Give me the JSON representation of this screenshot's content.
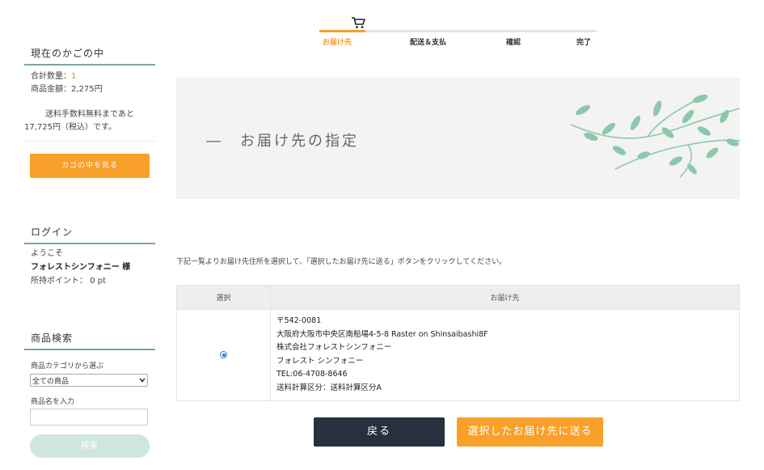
{
  "colors": {
    "accent": "#f8a02a",
    "heading_line": "#7aa898",
    "dark_button": "#26303e",
    "search_button": "#cfe6de",
    "leaf": "#8cc8aa"
  },
  "steps": {
    "icon": "cart-icon",
    "items": [
      "お届け先",
      "配送＆支払",
      "確認",
      "完了"
    ],
    "active_index": 0
  },
  "sidebar": {
    "cart": {
      "heading": "現在のかごの中",
      "qty_label": "合計数量：",
      "qty_value": "1",
      "price": "商品金額：2,275円",
      "note_line1": "送料手数料無料まであと",
      "note_line2": "17,725円（税込）です。",
      "view_cart_button": "カゴの中を見る"
    },
    "login": {
      "heading": "ログイン",
      "welcome": "ようこそ",
      "name": "フォレストシンフォニー 様",
      "points": "所持ポイント： 0 pt"
    },
    "search": {
      "heading": "商品検索",
      "category_label": "商品カテゴリから選ぶ",
      "category_selected": "全ての商品",
      "name_label": "商品名を入力",
      "name_value": "",
      "search_button": "検索"
    }
  },
  "main": {
    "banner_title": "―　お届け先の指定",
    "instruction": "下記一覧よりお届け先住所を選択して、「選択したお届け先に送る」ボタンをクリックしてください。",
    "table": {
      "headers": [
        "選択",
        "お届け先"
      ],
      "rows": [
        {
          "selected": true,
          "postal": "〒542-0081",
          "address": "大阪府大阪市中央区南船場4-5-8 Raster on Shinsaibashi8F",
          "company": "株式会社フォレストシンフォニー",
          "name": "フォレスト シンフォニー",
          "tel": "TEL:06-4708-8646",
          "shipping_class": "送料計算区分：送料計算区分A"
        }
      ]
    },
    "back_button": "戻る",
    "send_button": "選択したお届け先に送る"
  }
}
